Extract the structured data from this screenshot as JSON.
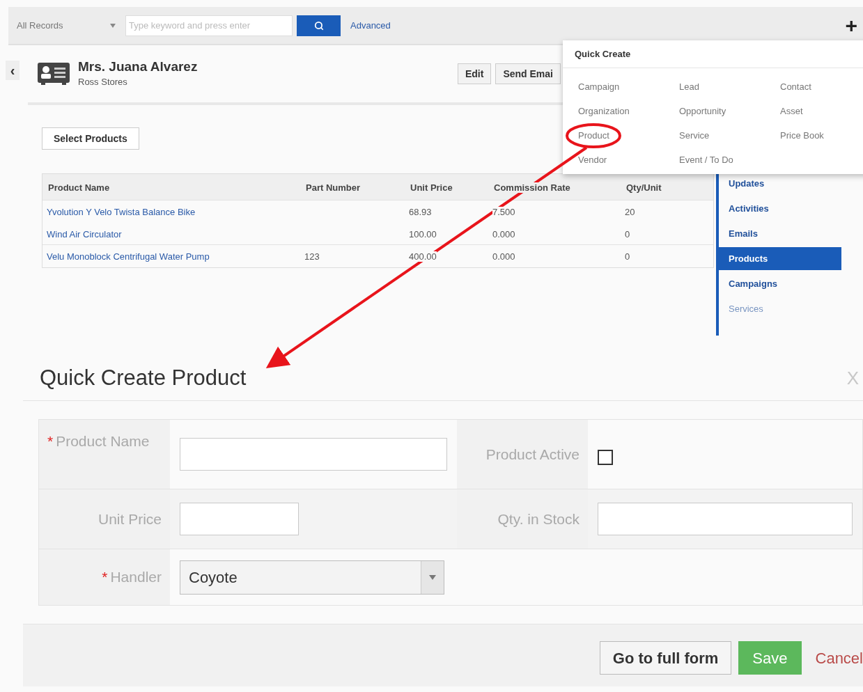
{
  "topbar": {
    "scope": "All Records",
    "search_placeholder": "Type keyword and press enter",
    "advanced": "Advanced",
    "add": "+"
  },
  "record": {
    "back": "‹",
    "title": "Mrs. Juana Alvarez",
    "subtitle": "Ross Stores",
    "buttons": [
      "Edit",
      "Send Emai"
    ]
  },
  "select_products": "Select Products",
  "table": {
    "columns": [
      "Product Name",
      "Part Number",
      "Unit Price",
      "Commission Rate",
      "Qty/Unit"
    ],
    "rows": [
      [
        "Yvolution Y Velo Twista Balance Bike",
        "",
        "68.93",
        "7.500",
        "20"
      ],
      [
        "Wind Air Circulator",
        "",
        "100.00",
        "0.000",
        "0"
      ],
      [
        "Velu Monoblock Centrifugal Water Pump",
        "123",
        "400.00",
        "0.000",
        "0"
      ]
    ]
  },
  "related_tabs": [
    {
      "label": "Updates",
      "selected": false
    },
    {
      "label": "Activities",
      "selected": false
    },
    {
      "label": "Emails",
      "selected": false
    },
    {
      "label": "Products",
      "selected": true
    },
    {
      "label": "Campaigns",
      "selected": false
    },
    {
      "label": "Services",
      "selected": false
    }
  ],
  "quick_create": {
    "title": "Quick Create",
    "items": [
      "Campaign",
      "Lead",
      "Contact",
      "Organization",
      "Opportunity",
      "Asset",
      "Product",
      "Service",
      "Price Book",
      "Vendor",
      "Event / To Do"
    ]
  },
  "modal": {
    "title": "Quick Create Product",
    "close": "X",
    "required_mark": "*",
    "rows": [
      [
        {
          "label": "Product Name",
          "kind": "text",
          "required": true
        },
        {
          "label": "Product Active",
          "kind": "checkbox",
          "required": false,
          "checked": false
        }
      ],
      [
        {
          "label": "Unit Price",
          "kind": "text",
          "required": false
        },
        {
          "label": "Qty. in Stock",
          "kind": "text",
          "required": false
        }
      ],
      [
        {
          "label": "Handler",
          "kind": "select",
          "required": true,
          "value": "Coyote"
        }
      ]
    ],
    "buttons": {
      "full_form": "Go to full form",
      "save": "Save",
      "cancel": "Cancel"
    }
  }
}
